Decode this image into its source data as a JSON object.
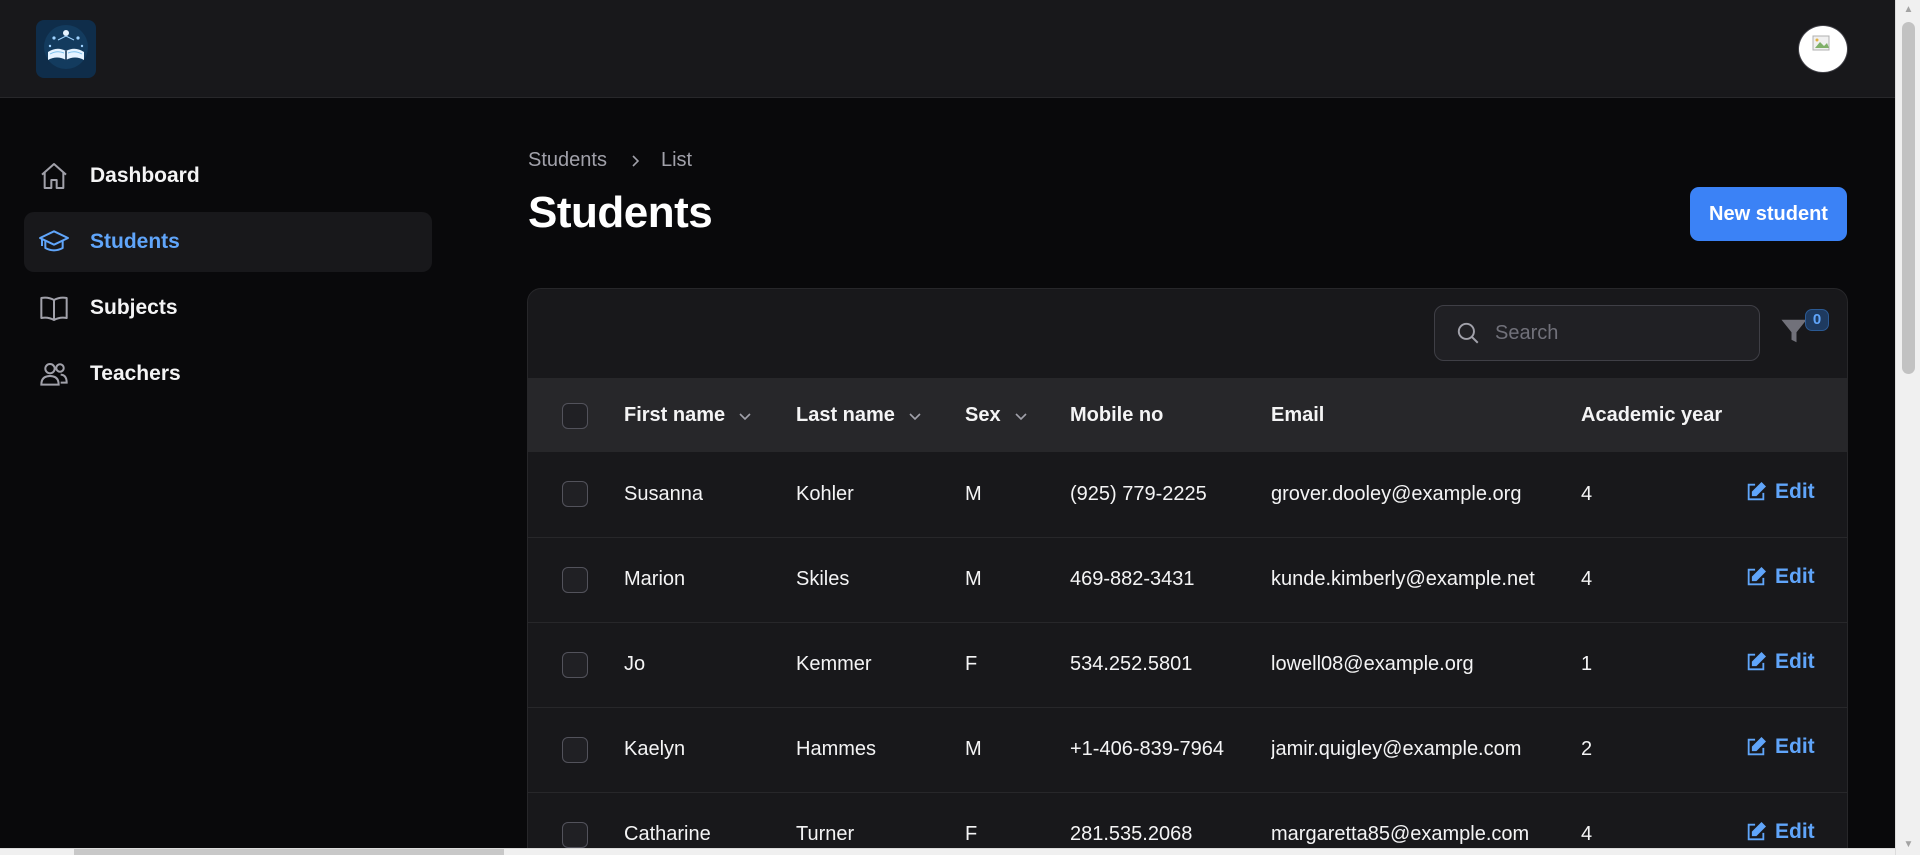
{
  "app": {
    "logo_icon": "open-book-logo",
    "avatar_icon": "user-avatar"
  },
  "sidebar": {
    "items": [
      {
        "label": "Dashboard",
        "icon": "home-icon",
        "active": false
      },
      {
        "label": "Students",
        "icon": "graduation-cap-icon",
        "active": true
      },
      {
        "label": "Subjects",
        "icon": "book-icon",
        "active": false
      },
      {
        "label": "Teachers",
        "icon": "users-icon",
        "active": false
      }
    ]
  },
  "breadcrumb": {
    "root": "Students",
    "current": "List"
  },
  "page": {
    "title": "Students",
    "new_button_label": "New student"
  },
  "toolbar": {
    "search_placeholder": "Search",
    "filter_count": "0"
  },
  "table": {
    "columns": [
      "First name",
      "Last name",
      "Sex",
      "Mobile no",
      "Email",
      "Academic year"
    ],
    "rows": [
      {
        "first_name": "Susanna",
        "last_name": "Kohler",
        "sex": "M",
        "mobile": "(925) 779-2225",
        "email": "grover.dooley@example.org",
        "year": "4"
      },
      {
        "first_name": "Marion",
        "last_name": "Skiles",
        "sex": "M",
        "mobile": "469-882-3431",
        "email": "kunde.kimberly@example.net",
        "year": "4"
      },
      {
        "first_name": "Jo",
        "last_name": "Kemmer",
        "sex": "F",
        "mobile": "534.252.5801",
        "email": "lowell08@example.org",
        "year": "1"
      },
      {
        "first_name": "Kaelyn",
        "last_name": "Hammes",
        "sex": "M",
        "mobile": "+1-406-839-7964",
        "email": "jamir.quigley@example.com",
        "year": "2"
      },
      {
        "first_name": "Catharine",
        "last_name": "Turner",
        "sex": "F",
        "mobile": "281.535.2068",
        "email": "margaretta85@example.com",
        "year": "4"
      }
    ],
    "edit_label": "Edit"
  },
  "colors": {
    "accent": "#3b82f6",
    "accent_text": "#60a5fa",
    "background": "#09090b",
    "surface": "#18181b"
  }
}
